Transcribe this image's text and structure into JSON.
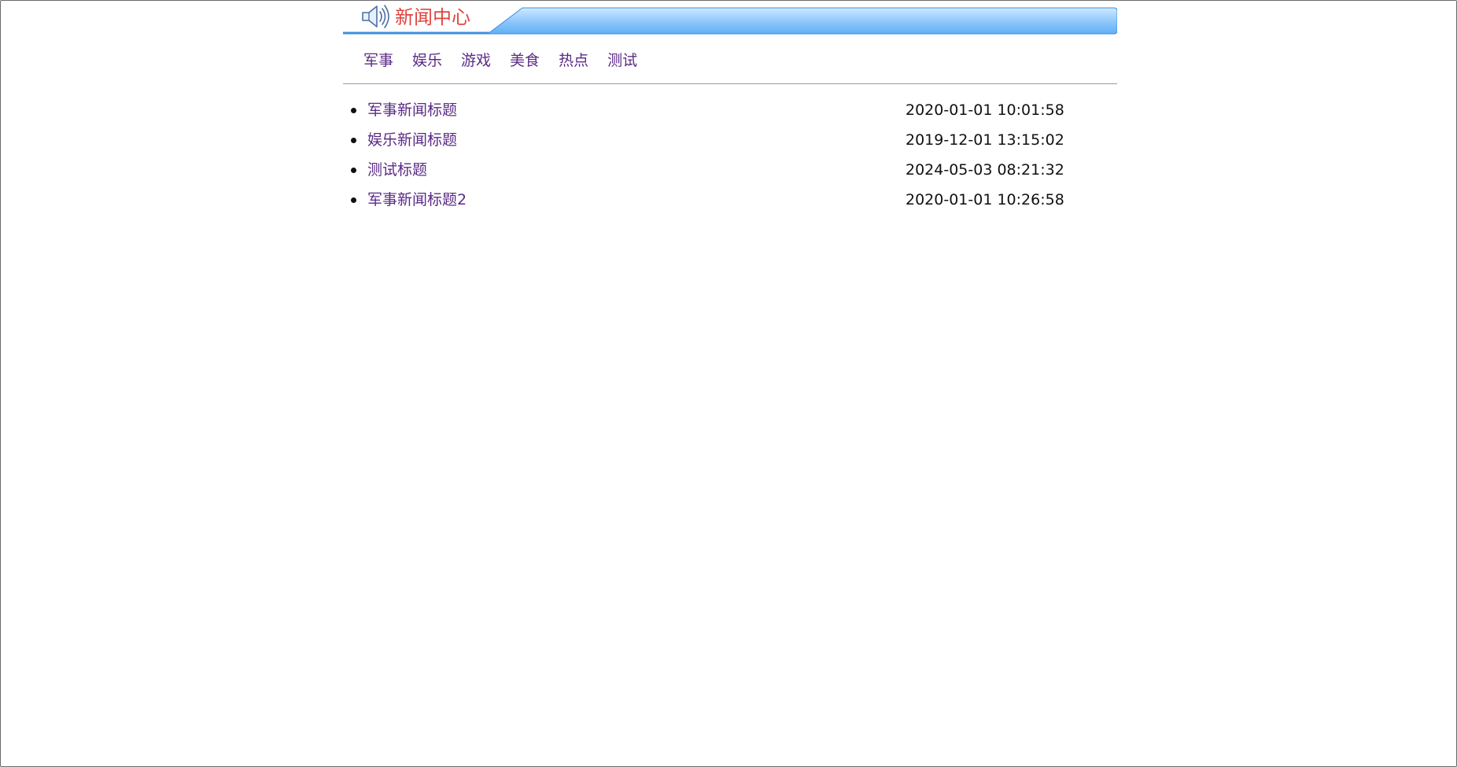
{
  "header": {
    "title": "新闻中心",
    "icon": "speaker-icon",
    "colors": {
      "title": "#e0443e",
      "banner_light": "#d2ebff",
      "banner_dark": "#6ab5f7",
      "banner_border": "#3c8fe0"
    }
  },
  "tabs": [
    {
      "label": "军事"
    },
    {
      "label": "娱乐"
    },
    {
      "label": "游戏"
    },
    {
      "label": "美食"
    },
    {
      "label": "热点"
    },
    {
      "label": "测试"
    }
  ],
  "news": [
    {
      "title": "军事新闻标题",
      "time": "2020-01-01 10:01:58"
    },
    {
      "title": "娱乐新闻标题",
      "time": "2019-12-01 13:15:02"
    },
    {
      "title": "测试标题",
      "time": "2024-05-03 08:21:32"
    },
    {
      "title": "军事新闻标题2",
      "time": "2020-01-01 10:26:58"
    }
  ],
  "colors": {
    "link": "#5b2a86",
    "text": "#111111",
    "divider": "#9a9a9a"
  }
}
